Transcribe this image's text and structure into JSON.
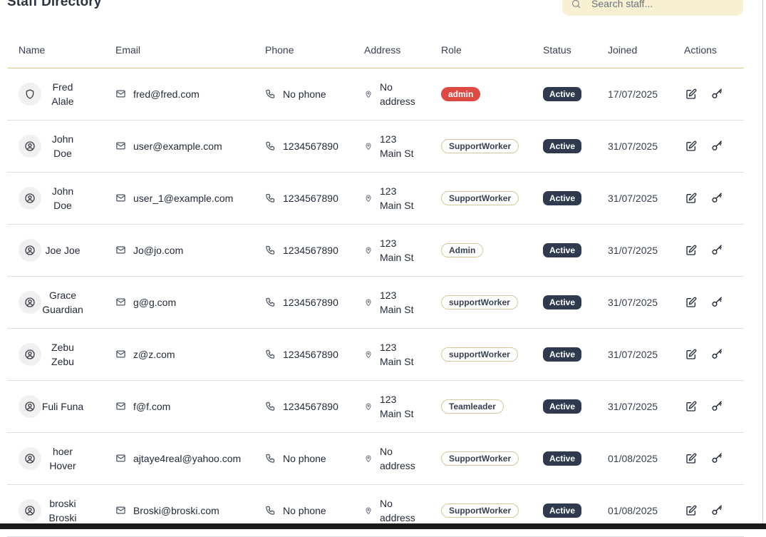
{
  "page_title": "Staff Directory",
  "search": {
    "placeholder": "Search staff...",
    "value": ""
  },
  "columns": [
    "Name",
    "Email",
    "Phone",
    "Address",
    "Role",
    "Status",
    "Joined",
    "Actions"
  ],
  "staff": [
    {
      "name_first": "Fred",
      "name_last": "Alale",
      "avatar_icon": "shield-icon",
      "email": "fred@fred.com",
      "phone": "No phone",
      "address_l1": "No",
      "address_l2": "address",
      "role": "admin",
      "role_style": "filled-red",
      "status": "Active",
      "joined": "17/07/2025"
    },
    {
      "name_first": "John",
      "name_last": "Doe",
      "avatar_icon": "user-circle-icon",
      "email": "user@example.com",
      "phone": "1234567890",
      "address_l1": "123",
      "address_l2": "Main St",
      "role": "SupportWorker",
      "role_style": "outline",
      "status": "Active",
      "joined": "31/07/2025"
    },
    {
      "name_first": "John",
      "name_last": "Doe",
      "avatar_icon": "user-circle-icon",
      "email": "user_1@example.com",
      "phone": "1234567890",
      "address_l1": "123",
      "address_l2": "Main St",
      "role": "SupportWorker",
      "role_style": "outline",
      "status": "Active",
      "joined": "31/07/2025"
    },
    {
      "name_first": "Joe Joe",
      "name_last": "",
      "avatar_icon": "user-circle-icon",
      "email": "Jo@jo.com",
      "phone": "1234567890",
      "address_l1": "123",
      "address_l2": "Main St",
      "role": "Admin",
      "role_style": "outline",
      "status": "Active",
      "joined": "31/07/2025"
    },
    {
      "name_first": "Grace",
      "name_last": "Guardian",
      "avatar_icon": "user-circle-icon",
      "email": "g@g.com",
      "phone": "1234567890",
      "address_l1": "123",
      "address_l2": "Main St",
      "role": "supportWorker",
      "role_style": "outline",
      "status": "Active",
      "joined": "31/07/2025"
    },
    {
      "name_first": "Zebu",
      "name_last": "Zebu",
      "avatar_icon": "user-circle-icon",
      "email": "z@z.com",
      "phone": "1234567890",
      "address_l1": "123",
      "address_l2": "Main St",
      "role": "supportWorker",
      "role_style": "outline",
      "status": "Active",
      "joined": "31/07/2025"
    },
    {
      "name_first": "Fuli Funa",
      "name_last": "",
      "avatar_icon": "user-circle-icon",
      "email": "f@f.com",
      "phone": "1234567890",
      "address_l1": "123",
      "address_l2": "Main St",
      "role": "Teamleader",
      "role_style": "outline",
      "status": "Active",
      "joined": "31/07/2025"
    },
    {
      "name_first": "hoer",
      "name_last": "Hover",
      "avatar_icon": "user-circle-icon",
      "email": "ajtaye4real@yahoo.com",
      "phone": "No phone",
      "address_l1": "No",
      "address_l2": "address",
      "role": "SupportWorker",
      "role_style": "outline",
      "status": "Active",
      "joined": "01/08/2025"
    },
    {
      "name_first": "broski",
      "name_last": "Broski",
      "avatar_icon": "user-circle-icon",
      "email": "Broski@broski.com",
      "phone": "No phone",
      "address_l1": "No",
      "address_l2": "address",
      "role": "SupportWorker",
      "role_style": "outline",
      "status": "Active",
      "joined": "01/08/2025"
    }
  ],
  "colors": {
    "accent_search_bg": "#f7f0d2",
    "header_divider": "#dcc98a",
    "admin_badge": "#dc4a43",
    "status_badge": "#2f3a4f",
    "role_outline": "#d6c79a"
  },
  "icons": {
    "search": "search-icon",
    "email": "mail-icon",
    "phone": "phone-icon",
    "address": "map-pin-icon",
    "edit": "edit-icon",
    "key": "key-icon"
  }
}
